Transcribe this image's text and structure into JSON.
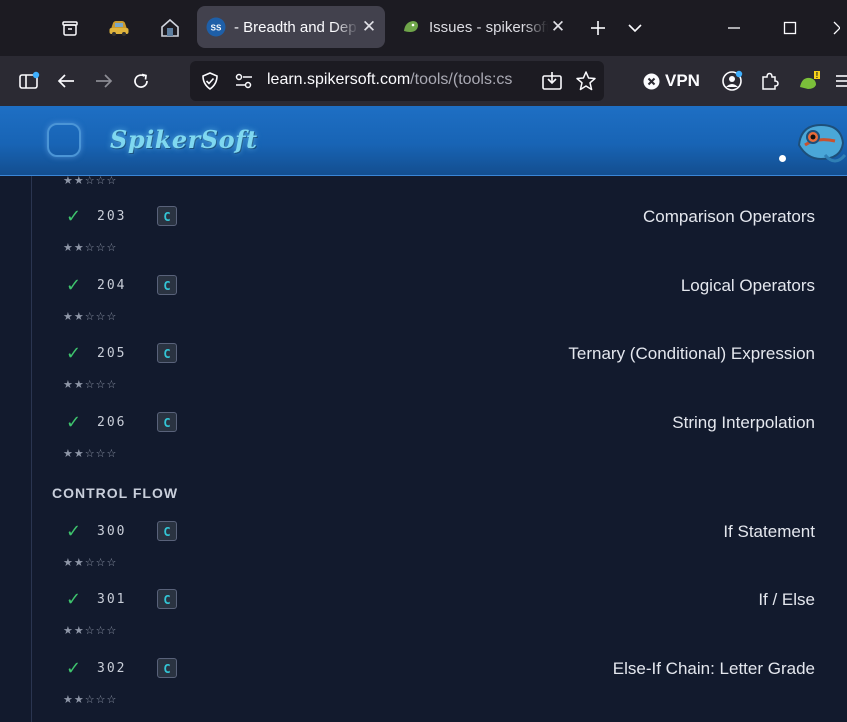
{
  "browser": {
    "tabs": [
      {
        "label": "- Breadth and Dep",
        "favicon_text": "SS",
        "active": true
      },
      {
        "label": "Issues - spikersoft",
        "active": false
      }
    ],
    "url": {
      "host": "learn.spikersoft.com",
      "path": "/tools/(tools:cs"
    },
    "vpn_label": "VPN",
    "extension_badge": "!"
  },
  "site": {
    "brand": "SpikerSoft"
  },
  "lessons_top": {
    "stars": "★★☆☆☆"
  },
  "sections": [
    {
      "id": "operators",
      "label": "",
      "lessons": [
        {
          "number": "203",
          "lang": "C",
          "title": "Comparison Operators",
          "done": true,
          "stars": "★★☆☆☆"
        },
        {
          "number": "204",
          "lang": "C",
          "title": "Logical Operators",
          "done": true,
          "stars": "★★☆☆☆"
        },
        {
          "number": "205",
          "lang": "C",
          "title": "Ternary (Conditional) Expression",
          "done": true,
          "stars": "★★☆☆☆"
        },
        {
          "number": "206",
          "lang": "C",
          "title": "String Interpolation",
          "done": true,
          "stars": "★★☆☆☆"
        }
      ]
    },
    {
      "id": "control-flow",
      "label": "CONTROL FLOW",
      "lessons": [
        {
          "number": "300",
          "lang": "C",
          "title": "If Statement",
          "done": true,
          "stars": "★★☆☆☆"
        },
        {
          "number": "301",
          "lang": "C",
          "title": "If / Else",
          "done": true,
          "stars": "★★☆☆☆"
        },
        {
          "number": "302",
          "lang": "C",
          "title": "Else-If Chain: Letter Grade",
          "done": true,
          "stars": "★★☆☆☆"
        }
      ]
    }
  ],
  "icons": {
    "check": "✓",
    "colors": {
      "accent": "#1e6fc4",
      "check": "#3ec46d",
      "badge_text": "#33c6d6",
      "page_bg": "#121a2d"
    }
  }
}
